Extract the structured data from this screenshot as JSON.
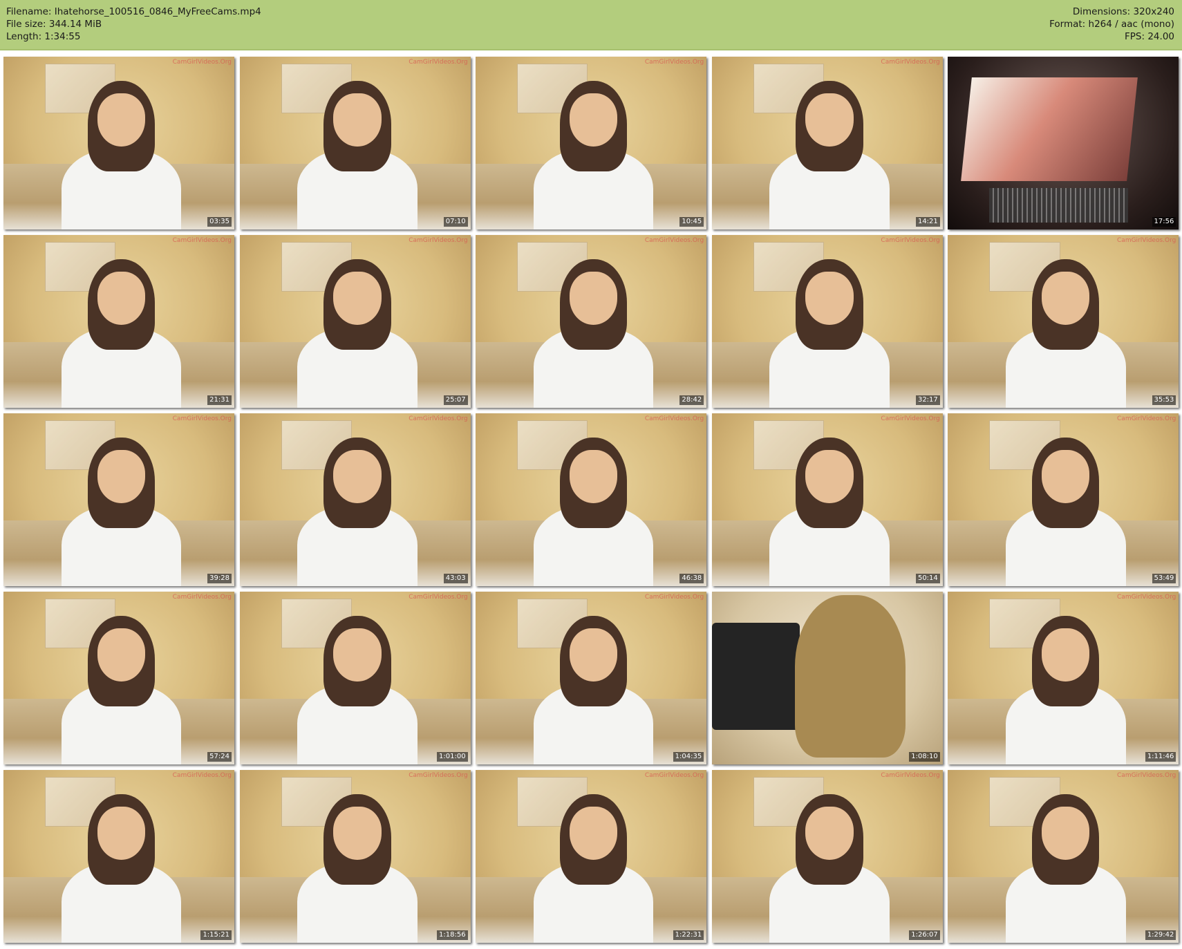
{
  "header": {
    "filename_line": "Filename: Ihatehorse_100516_0846_MyFreeCams.mp4",
    "filesize_line": "File size: 344.14 MiB",
    "length_line": "Length: 1:34:55",
    "dimensions_line": "Dimensions: 320x240",
    "format_line": "Format: h264 / aac (mono)",
    "fps_line": "FPS: 24.00",
    "background_color": "#b3cd7d"
  },
  "watermark_text": "CamGirlVideos.Org",
  "thumbnails": [
    {
      "timestamp": "03:35",
      "scene": "webcam"
    },
    {
      "timestamp": "07:10",
      "scene": "webcam"
    },
    {
      "timestamp": "10:45",
      "scene": "webcam"
    },
    {
      "timestamp": "14:21",
      "scene": "webcam"
    },
    {
      "timestamp": "17:56",
      "scene": "screen"
    },
    {
      "timestamp": "21:31",
      "scene": "webcam"
    },
    {
      "timestamp": "25:07",
      "scene": "webcam"
    },
    {
      "timestamp": "28:42",
      "scene": "webcam"
    },
    {
      "timestamp": "32:17",
      "scene": "webcam"
    },
    {
      "timestamp": "35:53",
      "scene": "webcam"
    },
    {
      "timestamp": "39:28",
      "scene": "webcam"
    },
    {
      "timestamp": "43:03",
      "scene": "webcam"
    },
    {
      "timestamp": "46:38",
      "scene": "webcam"
    },
    {
      "timestamp": "50:14",
      "scene": "webcam"
    },
    {
      "timestamp": "53:49",
      "scene": "webcam"
    },
    {
      "timestamp": "57:24",
      "scene": "webcam"
    },
    {
      "timestamp": "1:01:00",
      "scene": "webcam"
    },
    {
      "timestamp": "1:04:35",
      "scene": "webcam"
    },
    {
      "timestamp": "1:08:10",
      "scene": "room"
    },
    {
      "timestamp": "1:11:46",
      "scene": "webcam"
    },
    {
      "timestamp": "1:15:21",
      "scene": "webcam"
    },
    {
      "timestamp": "1:18:56",
      "scene": "webcam"
    },
    {
      "timestamp": "1:22:31",
      "scene": "webcam"
    },
    {
      "timestamp": "1:26:07",
      "scene": "webcam"
    },
    {
      "timestamp": "1:29:42",
      "scene": "webcam"
    }
  ]
}
